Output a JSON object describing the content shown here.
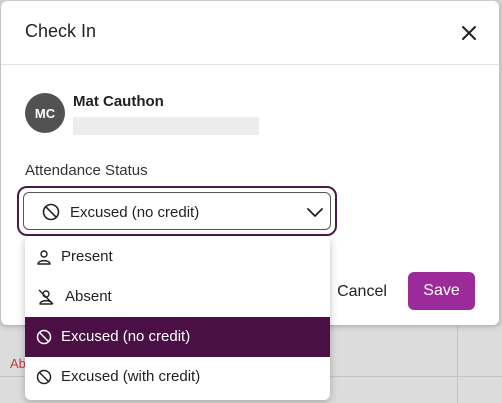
{
  "dialog": {
    "title": "Check In",
    "close_icon": "close-icon"
  },
  "student": {
    "initials": "MC",
    "name": "Mat Cauthon"
  },
  "attendance": {
    "label": "Attendance Status",
    "selected_value": "Excused (no credit)",
    "selected_icon": "ban-icon",
    "options": [
      {
        "label": "Present",
        "icon": "person-icon",
        "selected": false
      },
      {
        "label": "Absent",
        "icon": "person-slash-icon",
        "selected": false
      },
      {
        "label": "Excused (no credit)",
        "icon": "ban-icon",
        "selected": true
      },
      {
        "label": "Excused (with credit)",
        "icon": "ban-icon",
        "selected": false
      }
    ]
  },
  "footer": {
    "cancel_label": "Cancel",
    "save_label": "Save"
  },
  "background": {
    "row_text": "Ab"
  },
  "colors": {
    "accent": "#9c2a9a",
    "selected_item": "#4a1046",
    "select_focus_border": "#4a1b4a"
  }
}
